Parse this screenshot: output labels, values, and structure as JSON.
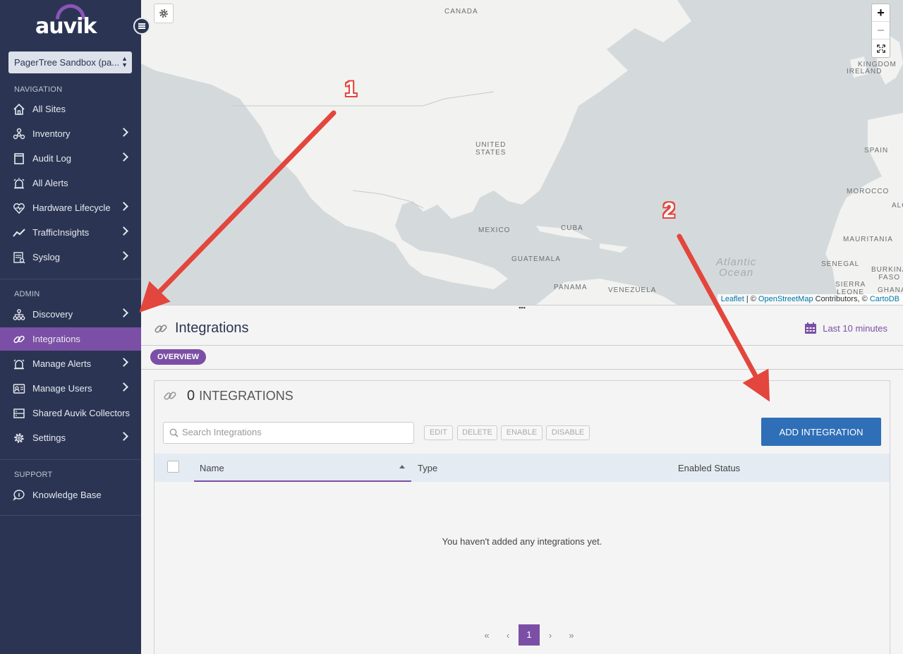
{
  "brand": {
    "logo_text": "auvik"
  },
  "tenant": {
    "selected": "PagerTree Sandbox (pa..."
  },
  "sidebar": {
    "navigation_heading": "NAVIGATION",
    "admin_heading": "ADMIN",
    "support_heading": "SUPPORT",
    "navigation": [
      {
        "label": "All Sites",
        "icon": "home-icon"
      },
      {
        "label": "Inventory",
        "icon": "inventory-icon"
      },
      {
        "label": "Audit Log",
        "icon": "audit-log-icon"
      },
      {
        "label": "All Alerts",
        "icon": "alarm-icon"
      },
      {
        "label": "Hardware Lifecycle",
        "icon": "heart-icon"
      },
      {
        "label": "TrafficInsights",
        "icon": "traffic-icon"
      },
      {
        "label": "Syslog",
        "icon": "syslog-icon"
      }
    ],
    "admin": [
      {
        "label": "Discovery",
        "icon": "discovery-icon"
      },
      {
        "label": "Integrations",
        "icon": "link-icon"
      },
      {
        "label": "Manage Alerts",
        "icon": "alarm-icon"
      },
      {
        "label": "Manage Users",
        "icon": "users-icon"
      },
      {
        "label": "Shared Auvik Collectors",
        "icon": "collector-icon"
      },
      {
        "label": "Settings",
        "icon": "gear-icon"
      }
    ],
    "support": [
      {
        "label": "Knowledge Base",
        "icon": "info-bubble-icon"
      }
    ]
  },
  "map": {
    "labels": {
      "canada": "CANADA",
      "united_states": "UNITED\nSTATES",
      "mexico": "MEXICO",
      "cuba": "CUBA",
      "guatemala": "GUATEMALA",
      "panama": "PANAMA",
      "venezuela": "VENEZUELA",
      "ireland": "IRELAND",
      "united_kingdom": "KINGDOM",
      "spain": "SPAIN",
      "morocco": "MOROCCO",
      "mauritania": "MAURITANIA",
      "senegal": "SENEGAL",
      "burkina_faso": "BURKINA\nFASO",
      "sierra_leone": "SIERRA\nLEONE",
      "ghana": "GHANA",
      "algeria": "ALG",
      "atlantic": "Atlantic\nOcean"
    },
    "zoom_in": "+",
    "zoom_out": "−",
    "attribution": {
      "leaflet": "Leaflet",
      "sep1": " | © ",
      "osm": "OpenStreetMap",
      "contrib": " Contributors, © ",
      "carto": "CartoDB"
    }
  },
  "page": {
    "title": "Integrations",
    "time_range": "Last 10 minutes",
    "tab_overview": "OVERVIEW"
  },
  "panel": {
    "count": "0",
    "title": "INTEGRATIONS",
    "search_placeholder": "Search Integrations",
    "edit": "EDIT",
    "delete": "DELETE",
    "enable": "ENABLE",
    "disable": "DISABLE",
    "add_button": "ADD INTEGRATION",
    "columns": {
      "name": "Name",
      "type": "Type",
      "status": "Enabled Status"
    },
    "empty_message": "You haven't added any integrations yet.",
    "pager": {
      "first": "«",
      "prev": "‹",
      "current": "1",
      "next": "›",
      "last": "»"
    }
  },
  "annotations": {
    "callout_1": "1",
    "callout_2": "2",
    "arrow_color": "#e3463c"
  },
  "colors": {
    "sidebar_bg": "#2b3553",
    "accent": "#7b4fa5",
    "primary_button": "#2f6fb8",
    "map_land": "#f2f2f0",
    "map_water": "#d4dadc"
  }
}
